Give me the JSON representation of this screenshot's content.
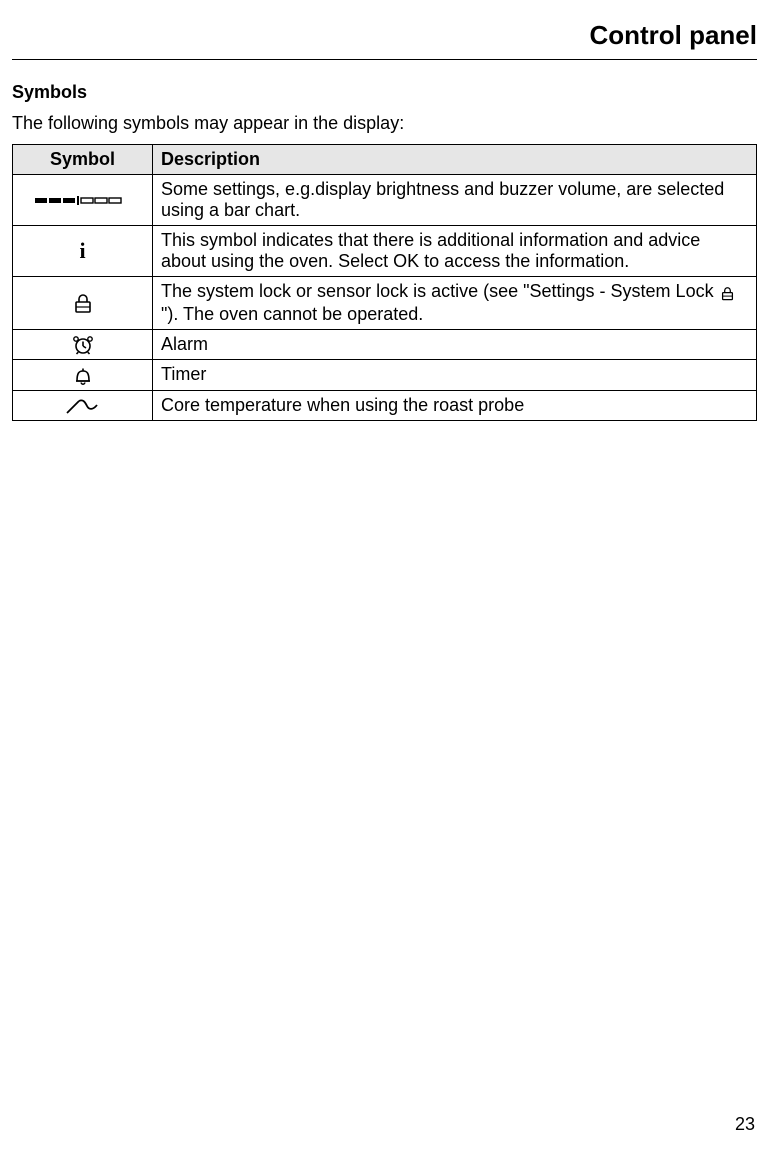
{
  "page_title": "Control panel",
  "section_heading": "Symbols",
  "intro": "The following symbols may appear in the display:",
  "table": {
    "headers": {
      "symbol": "Symbol",
      "description": "Description"
    },
    "rows": [
      {
        "icon": "bar-chart-icon",
        "description": "Some settings, e.g.display brightness and buzzer volume, are selected using a bar chart."
      },
      {
        "icon": "info-icon",
        "description": "This symbol indicates that there is additional information and advice about using the oven. Select OK to access the information."
      },
      {
        "icon": "lock-icon",
        "desc_pre": "The system lock or sensor lock is active (see \"Settings - System Lock ",
        "desc_post": "\"). The oven cannot be operated."
      },
      {
        "icon": "alarm-icon",
        "description": "Alarm"
      },
      {
        "icon": "timer-icon",
        "description": "Timer"
      },
      {
        "icon": "probe-icon",
        "description": "Core temperature when using the roast probe"
      }
    ]
  },
  "page_number": "23"
}
